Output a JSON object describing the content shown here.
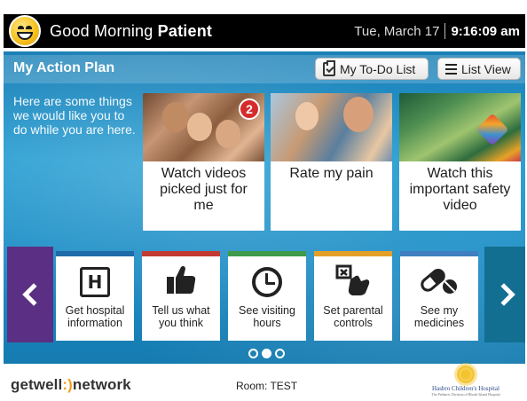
{
  "header": {
    "greeting_prefix": "Good Morning",
    "greeting_name": "Patient",
    "date": "Tue, March 17",
    "time": "9:16:09 am"
  },
  "plan": {
    "title": "My Action Plan",
    "todo_label": "My To-Do List",
    "listview_label": "List View",
    "intro": "Here are some things we would like you to do while you are here."
  },
  "cards": [
    {
      "caption": "Watch videos picked just for me",
      "badge": "2"
    },
    {
      "caption": "Rate my pain"
    },
    {
      "caption": "Watch this important safety video"
    }
  ],
  "tiles": [
    {
      "label": "Get hospital information",
      "icon": "hospital-icon"
    },
    {
      "label": "Tell us what you think",
      "icon": "thumbs-up-icon"
    },
    {
      "label": "See visiting hours",
      "icon": "clock-icon"
    },
    {
      "label": "Set parental controls",
      "icon": "parental-controls-icon"
    },
    {
      "label": "See my medicines",
      "icon": "pill-icon"
    }
  ],
  "carousel": {
    "page_count": 3,
    "active_page": 2
  },
  "footer": {
    "logo_left": "getwell",
    "logo_mid": ":)",
    "logo_right": "network",
    "room": "Room: TEST",
    "hospital_name": "Hasbro Children's Hospital",
    "hospital_sub": "The Pediatric Division of Rhode Island Hospital"
  },
  "colors": {
    "header_bg": "#000000",
    "accent_blue": "#1d8cc4",
    "prev_button": "#5b2f83",
    "next_button": "#136f92",
    "badge": "#d52b2b"
  }
}
